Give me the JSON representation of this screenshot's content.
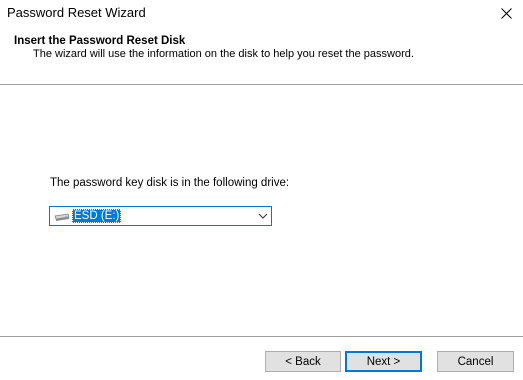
{
  "window": {
    "title": "Password Reset Wizard",
    "close_icon": "close-icon"
  },
  "header": {
    "title": "Insert the Password Reset Disk",
    "subtitle": "The wizard will use the information on the disk to help you reset the password."
  },
  "main": {
    "drive_label": "The password key disk is in the following drive:",
    "drive_select": {
      "selected_value": "ESD (E:)",
      "icon": "removable-drive-icon"
    }
  },
  "buttons": {
    "back": "< Back",
    "next": "Next >",
    "cancel": "Cancel"
  },
  "colors": {
    "accent": "#0078d7",
    "divider": "#a0a0a0",
    "button_face": "#e1e1e1"
  }
}
